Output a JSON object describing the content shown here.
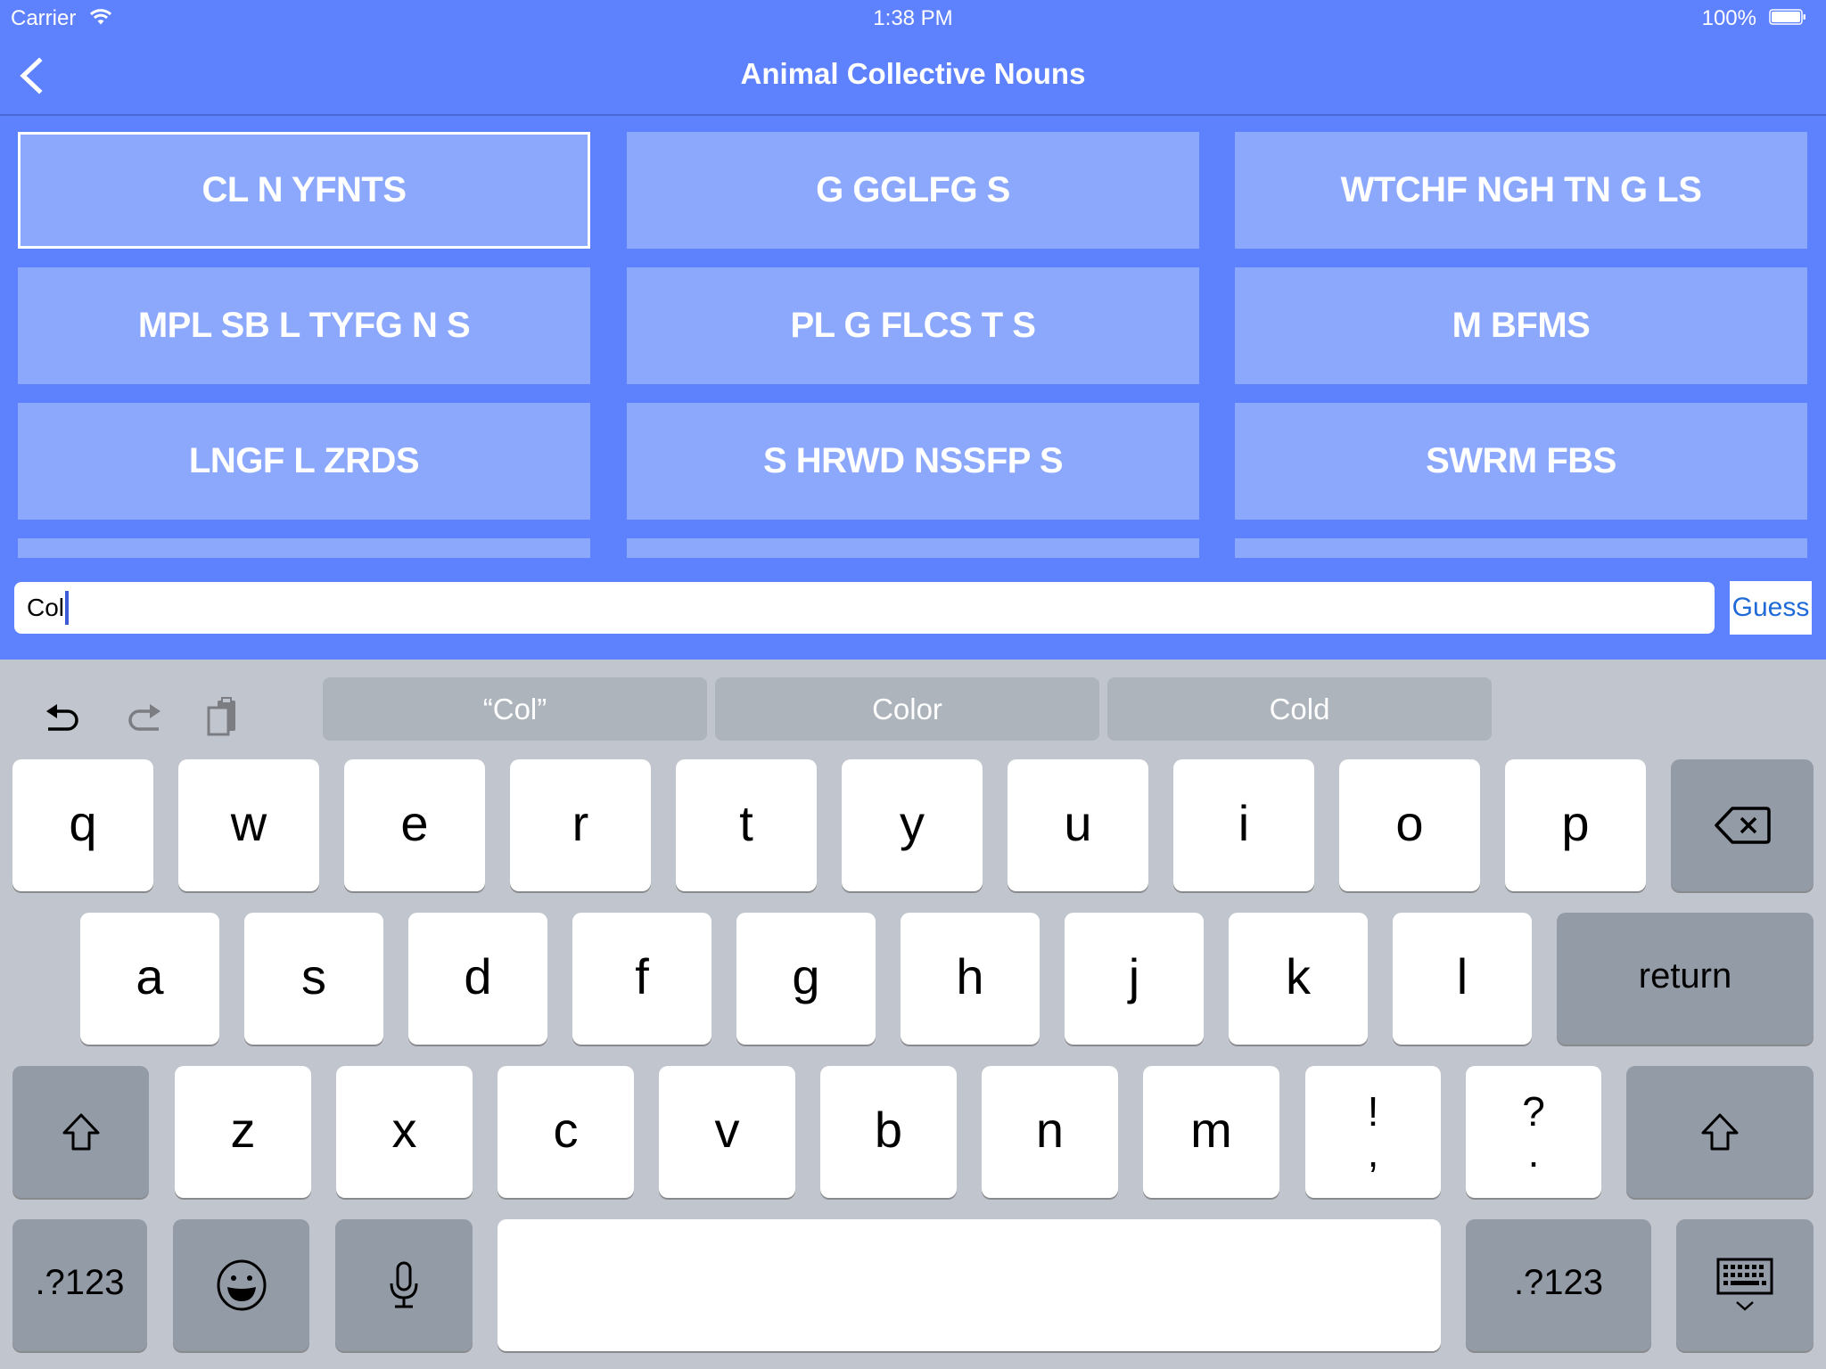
{
  "status_bar": {
    "carrier": "Carrier",
    "time": "1:38 PM",
    "battery_percent": "100%"
  },
  "nav": {
    "title": "Animal Collective Nouns"
  },
  "colors": {
    "background": "#5e81fe",
    "tile": "#8ba8fd",
    "keyboard": "#c1c5cd",
    "function_key": "#939ba7",
    "suggestion": "#adb4bc",
    "guess_text": "#1f6ad6"
  },
  "tiles": [
    {
      "text": "CL N YFNTS",
      "selected": true
    },
    {
      "text": "G GGLFG S",
      "selected": false
    },
    {
      "text": "WTCHF NGH TN G LS",
      "selected": false
    },
    {
      "text": "MPL SB L TYFG N S",
      "selected": false
    },
    {
      "text": "PL G FLCS T S",
      "selected": false
    },
    {
      "text": "M BFMS",
      "selected": false
    },
    {
      "text": "LNGF L ZRDS",
      "selected": false
    },
    {
      "text": "S HRWD NSSFP S",
      "selected": false
    },
    {
      "text": "SWRM FBS",
      "selected": false
    },
    {
      "text": "",
      "selected": false
    },
    {
      "text": "",
      "selected": false
    },
    {
      "text": "",
      "selected": false
    }
  ],
  "input": {
    "value": "Col"
  },
  "guess_button": {
    "label": "Guess"
  },
  "keyboard": {
    "suggestions": [
      "“Col”",
      "Color",
      "Cold"
    ],
    "row1": [
      "q",
      "w",
      "e",
      "r",
      "t",
      "y",
      "u",
      "i",
      "o",
      "p"
    ],
    "row2": [
      "a",
      "s",
      "d",
      "f",
      "g",
      "h",
      "j",
      "k",
      "l"
    ],
    "row3": [
      "z",
      "x",
      "c",
      "v",
      "b",
      "n",
      "m"
    ],
    "punct1": {
      "top": "!",
      "bottom": ","
    },
    "punct2": {
      "top": "?",
      "bottom": "."
    },
    "return_label": "return",
    "numbers_label": ".?123",
    "icons": {
      "undo": "undo-icon",
      "redo": "redo-icon",
      "paste": "paste-icon",
      "backspace": "backspace-icon",
      "shift": "shift-icon",
      "emoji": "emoji-icon",
      "mic": "microphone-icon",
      "dismiss": "keyboard-dismiss-icon"
    }
  }
}
